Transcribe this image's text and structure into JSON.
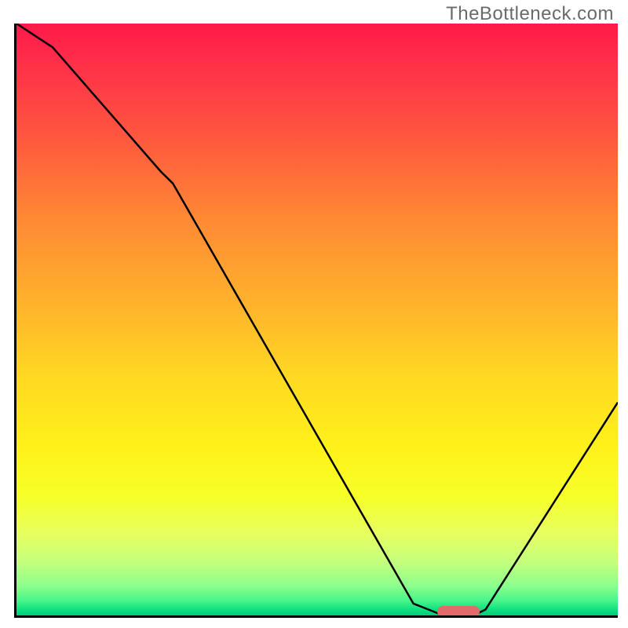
{
  "watermark": "TheBottleneck.com",
  "chart_data": {
    "type": "line",
    "title": "",
    "xlabel": "",
    "ylabel": "",
    "xlim": [
      0,
      100
    ],
    "ylim": [
      0,
      100
    ],
    "grid": false,
    "legend": false,
    "series": [
      {
        "name": "curve",
        "x": [
          0,
          6,
          24,
          26,
          66,
          71,
          76,
          78,
          100
        ],
        "y": [
          100,
          96,
          75,
          73,
          2,
          0,
          0,
          1,
          36
        ]
      }
    ],
    "marker": {
      "x_start": 70,
      "x_end": 77,
      "y": 0.6
    },
    "background": {
      "type": "vertical_gradient",
      "stops": [
        {
          "pos": 0.0,
          "color": "#ff1a4b"
        },
        {
          "pos": 0.2,
          "color": "#ff5a3e"
        },
        {
          "pos": 0.48,
          "color": "#ffb42c"
        },
        {
          "pos": 0.72,
          "color": "#fff21a"
        },
        {
          "pos": 0.91,
          "color": "#c4ff7e"
        },
        {
          "pos": 1.0,
          "color": "#00cc7a"
        }
      ]
    }
  }
}
